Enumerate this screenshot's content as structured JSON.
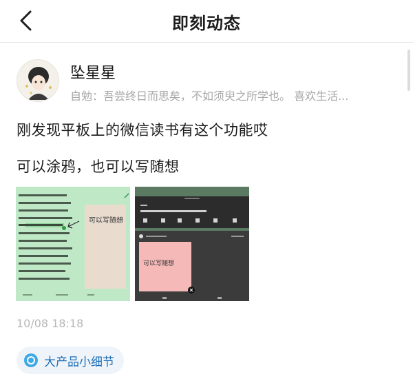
{
  "header": {
    "title": "即刻动态"
  },
  "post": {
    "author": {
      "name": "坠星星",
      "bio": "自勉：吾尝终日而思矣，不如须臾之所学也。 喜欢生活..."
    },
    "lines": [
      "刚发现平板上的微信读书有这个功能哎",
      "可以涂鸦，也可以写随想"
    ],
    "images": [
      {
        "handwriting": "可以写随想"
      },
      {
        "handwriting": "可以写随想"
      }
    ],
    "timestamp": "10/08 18:18",
    "topic": {
      "label": "大产品小细节"
    }
  },
  "colors": {
    "accent": "#1f6fb8",
    "tag_bg": "#eef4fa",
    "green_page": "#bfe8c6",
    "dark_app": "#3b3b3b",
    "pink_note": "#f5b9b8"
  },
  "icons": [
    "back-icon",
    "topic-icon",
    "pencil-icon",
    "close-icon"
  ]
}
